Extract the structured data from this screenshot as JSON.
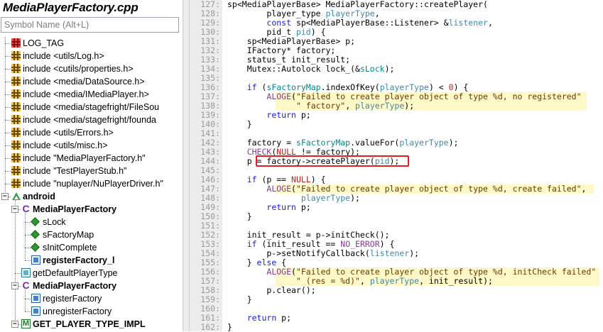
{
  "window": {
    "file_title": "MediaPlayerFactory.cpp"
  },
  "search": {
    "placeholder": "Symbol Name (Alt+L)"
  },
  "tree": [
    {
      "label": "LOG_TAG",
      "icon": "define-icon"
    },
    {
      "label": "include <utils/Log.h>",
      "icon": "include-icon"
    },
    {
      "label": "include <cutils/properties.h>",
      "icon": "include-icon"
    },
    {
      "label": "include <media/DataSource.h>",
      "icon": "include-icon"
    },
    {
      "label": "include <media/IMediaPlayer.h>",
      "icon": "include-icon"
    },
    {
      "label": "include <media/stagefright/FileSou",
      "icon": "include-icon"
    },
    {
      "label": "include <media/stagefright/founda",
      "icon": "include-icon"
    },
    {
      "label": "include <utils/Errors.h>",
      "icon": "include-icon"
    },
    {
      "label": "include <utils/misc.h>",
      "icon": "include-icon"
    },
    {
      "label": "include \"MediaPlayerFactory.h\"",
      "icon": "include-icon"
    },
    {
      "label": "include \"TestPlayerStub.h\"",
      "icon": "include-icon"
    },
    {
      "label": "include \"nuplayer/NuPlayerDriver.h\"",
      "icon": "include-icon"
    },
    {
      "label": "android",
      "icon": "namespace-icon",
      "bold": true
    },
    {
      "label": "MediaPlayerFactory",
      "icon": "class-icon",
      "bold": true
    },
    {
      "label": "sLock",
      "icon": "variable-icon"
    },
    {
      "label": "sFactoryMap",
      "icon": "variable-icon"
    },
    {
      "label": "sInitComplete",
      "icon": "variable-icon"
    },
    {
      "label": "registerFactory_l",
      "icon": "function-icon",
      "bold": true
    },
    {
      "label": "getDefaultPlayerType",
      "icon": "function-icon"
    },
    {
      "label": "MediaPlayerFactory",
      "icon": "class-icon",
      "bold": true
    },
    {
      "label": "registerFactory",
      "icon": "function-icon"
    },
    {
      "label": "unregisterFactory",
      "icon": "function-icon"
    },
    {
      "label": "GET_PLAYER_TYPE_IMPL",
      "icon": "macro-icon",
      "bold": true
    }
  ],
  "line_numbers": [
    "127:",
    "128:",
    "129:",
    "130:",
    "131:",
    "132:",
    "133:",
    "134:",
    "135:",
    "136:",
    "137:",
    "138:",
    "139:",
    "140:",
    "141:",
    "142:",
    "143:",
    "144:",
    "145:",
    "146:",
    "147:",
    "148:",
    "149:",
    "150:",
    "151:",
    "152:",
    "153:",
    "154:",
    "155:",
    "156:",
    "157:",
    "158:",
    "159:",
    "160:",
    "161:",
    "162:"
  ],
  "code": [
    "sp<MediaPlayerBase> MediaPlayerFactory::createPlayer(",
    "        player_type playerType,",
    "        const sp<MediaPlayerBase::Listener> &listener,",
    "        pid_t pid) {",
    "    sp<MediaPlayerBase> p;",
    "    IFactory* factory;",
    "    status_t init_result;",
    "    Mutex::Autolock lock_(&sLock);",
    "",
    "    if (sFactoryMap.indexOfKey(playerType) < 0) {",
    "        ALOGE(\"Failed to create player object of type %d, no registered\"",
    "              \" factory\", playerType);",
    "        return p;",
    "    }",
    "",
    "    factory = sFactoryMap.valueFor(playerType);",
    "    CHECK(NULL != factory);",
    "    p = factory->createPlayer(pid);",
    "",
    "    if (p == NULL) {",
    "        ALOGE(\"Failed to create player object of type %d, create failed\",",
    "               playerType);",
    "        return p;",
    "    }",
    "",
    "    init_result = p->initCheck();",
    "    if (init_result == NO_ERROR) {",
    "        p->setNotifyCallback(listener);",
    "    } else {",
    "        ALOGE(\"Failed to create player object of type %d, initCheck failed\"",
    "              \" (res = %d)\", playerType, init_result);",
    "        p.clear();",
    "    }",
    "",
    "    return p;",
    "}"
  ],
  "highlight": {
    "text": "factory->createPlayer(pid);",
    "line": "144:",
    "color": "#e02020"
  },
  "colors": {
    "keyword": "#1b1bdc",
    "string": "#6a3a00",
    "highlight_bg": "#fff8c8",
    "gutter": "#ececec",
    "macro": "#8a3a98"
  }
}
